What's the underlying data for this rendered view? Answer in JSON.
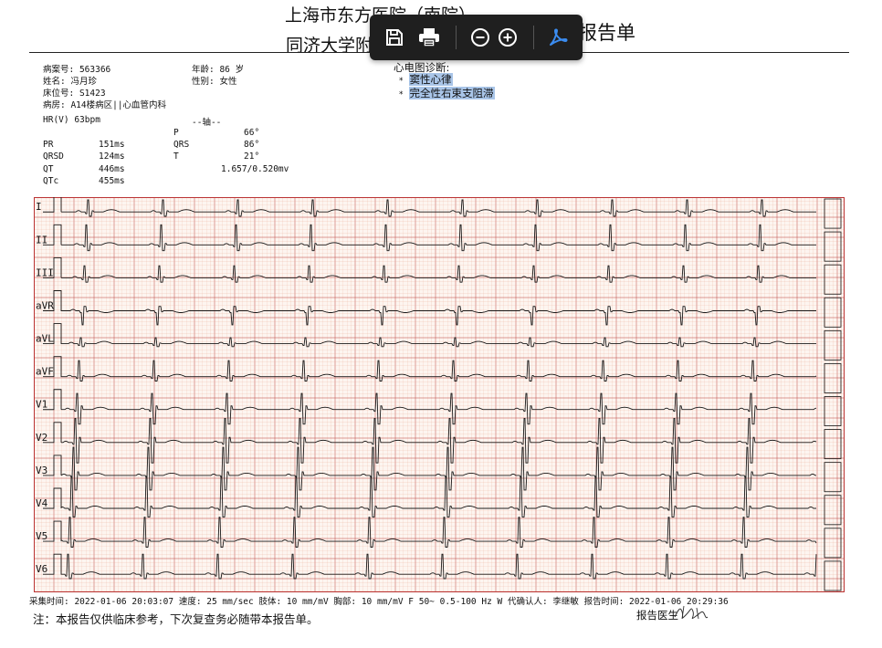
{
  "header": {
    "title_line1": "上海市东方医院（南院）",
    "title_line2_left": "同济大学附",
    "title_line2_right": "报告单"
  },
  "toolbar": {
    "items": [
      "save-icon",
      "print-icon",
      "zoom-out-icon",
      "zoom-in-icon",
      "acrobat-icon"
    ]
  },
  "patient": {
    "case_no": "病案号: 563366",
    "age": "年龄: 86 岁",
    "name": "姓名: 冯月珍",
    "sex": "性别: 女性",
    "bed": "床位号:   S1423",
    "ward": "病房: A14楼病区||心血管内科"
  },
  "measurements": {
    "hr": "HR(V)    63bpm",
    "axis_title": "--轴--",
    "p_label": "P",
    "p_value": "66°",
    "pr_label": "PR",
    "pr_value": "151ms",
    "qrs_label": "QRS",
    "qrs_value": "86°",
    "qrsd_label": "QRSD",
    "qrsd_value": "124ms",
    "t_label": "T",
    "t_value": "21°",
    "qt_label": "QT",
    "qt_value": "446ms",
    "rv": "1.657/0.520mv",
    "qtc_label": "QTc",
    "qtc_value": "455ms"
  },
  "diagnosis": {
    "title": "心电图诊断:",
    "items": [
      "窦性心律",
      "完全性右束支阻滞"
    ],
    "bullet": "*"
  },
  "ecg": {
    "leads": [
      "I",
      "II",
      "III",
      "aVR",
      "aVL",
      "aVF",
      "V1",
      "V2",
      "V3",
      "V4",
      "V5",
      "V6"
    ],
    "grid_color": "#e7a58c",
    "major_color": "#c0504d",
    "trace_color": "#1a1a1a"
  },
  "footer": {
    "line": "采集时间: 2022-01-06 20:03:07    速度: 25 mm/sec  肢体: 10 mm/mV  胸部: 10 mm/mV  F 50~ 0.5-100 Hz W  代确认人: 李继敏  报告时间: 2022-01-06 20:29:36",
    "note": "注：本报告仅供临床参考，下次复查务必随带本报告单。",
    "doctor_label": "报告医生"
  }
}
